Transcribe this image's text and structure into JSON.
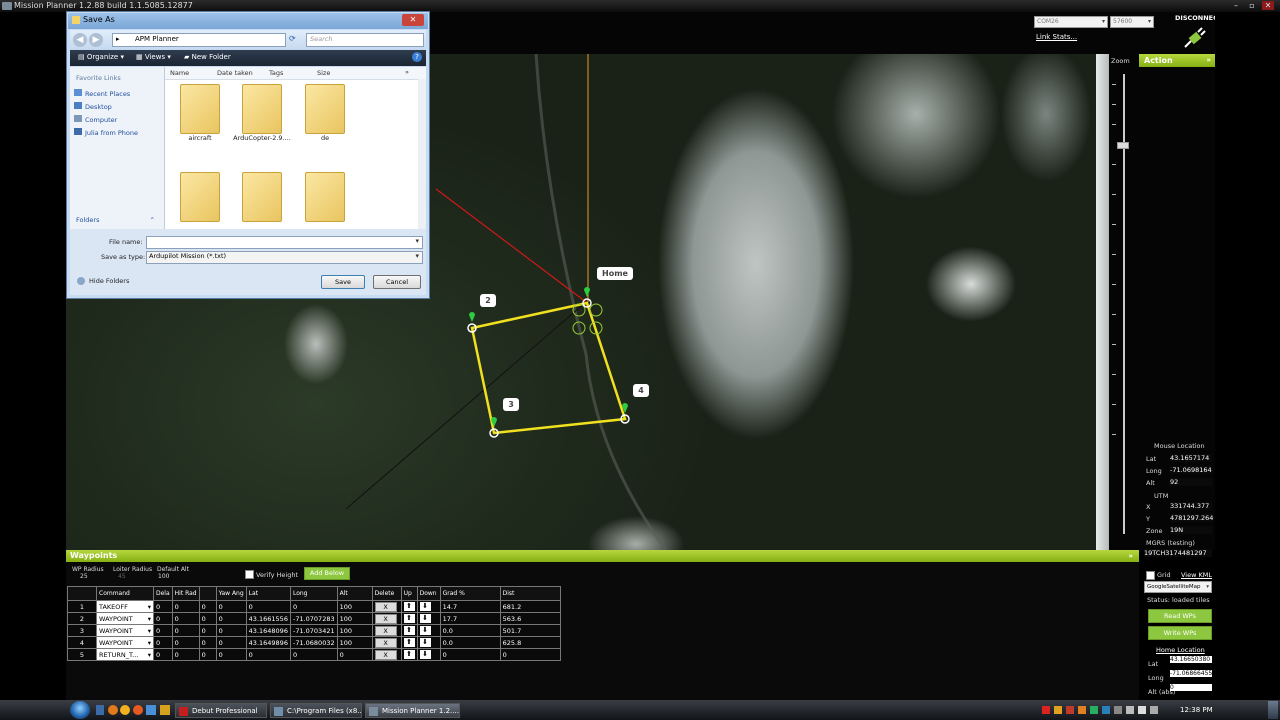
{
  "window": {
    "title": "Mission Planner 1.2.88 build 1.1.5085.12877"
  },
  "header": {
    "com_port": "COM26",
    "baud": "57600",
    "link_stats": "Link Stats...",
    "disconnect": "DISCONNECT"
  },
  "right_panel": {
    "action_label": "Action",
    "zoom_label": "Zoom",
    "mouse_location": "Mouse Location",
    "lat_label": "Lat",
    "lat_value": "43.1657174",
    "long_label": "Long",
    "long_value": "-71.0698164",
    "alt_label": "Alt",
    "alt_value": "92",
    "utm_label": "UTM",
    "x_label": "X",
    "x_value": "331744.377",
    "y_label": "Y",
    "y_value": "4781297.264",
    "zone_label": "Zone",
    "zone_value": "19N",
    "mgrs_label": "MGRS (testing)",
    "mgrs_value": "19TCH3174481297",
    "grid_label": "Grid",
    "view_kml": "View KML",
    "map_type": "GoogleSatelliteMap",
    "status": "Status: loaded tiles",
    "read_wps": "Read WPs",
    "write_wps": "Write WPs",
    "home_location": "Home Location",
    "home_lat_label": "Lat",
    "home_lat": "43.16650380",
    "home_long_label": "Long",
    "home_long": "-71.06866455",
    "home_alt_label": "Alt (abs)",
    "home_alt": "0"
  },
  "map": {
    "home_label": "Home",
    "wp_labels": [
      "2",
      "3",
      "4"
    ]
  },
  "waypoints": {
    "title": "Waypoints",
    "wp_radius_label": "WP Radius",
    "wp_radius": "25",
    "loiter_radius_label": "Loiter Radius",
    "loiter_radius": "45",
    "default_alt_label": "Default Alt",
    "default_alt": "100",
    "verify_height": "Verify Height",
    "add_below": "Add Below",
    "columns": [
      "",
      "Command",
      "Dela",
      "Hit Rad",
      "",
      "Yaw Ang",
      "Lat",
      "Long",
      "Alt",
      "Delete",
      "Up",
      "Down",
      "Grad %",
      "Dist"
    ],
    "rows": [
      {
        "idx": "1",
        "cmd": "TAKEOFF",
        "p1": "0",
        "p2": "0",
        "p3": "0",
        "p4": "0",
        "lat": "0",
        "lng": "0",
        "alt": "100",
        "grad": "14.7",
        "dist": "681.2"
      },
      {
        "idx": "2",
        "cmd": "WAYPOINT",
        "p1": "0",
        "p2": "0",
        "p3": "0",
        "p4": "0",
        "lat": "43.1661556",
        "lng": "-71.0707283",
        "alt": "100",
        "grad": "17.7",
        "dist": "563.6"
      },
      {
        "idx": "3",
        "cmd": "WAYPOINT",
        "p1": "0",
        "p2": "0",
        "p3": "0",
        "p4": "0",
        "lat": "43.1648096",
        "lng": "-71.0703421",
        "alt": "100",
        "grad": "0.0",
        "dist": "501.7"
      },
      {
        "idx": "4",
        "cmd": "WAYPOINT",
        "p1": "0",
        "p2": "0",
        "p3": "0",
        "p4": "0",
        "lat": "43.1649896",
        "lng": "-71.0680032",
        "alt": "100",
        "grad": "0.0",
        "dist": "625.8"
      },
      {
        "idx": "5",
        "cmd": "RETURN_T...",
        "p1": "0",
        "p2": "0",
        "p3": "0",
        "p4": "0",
        "lat": "0",
        "lng": "0",
        "alt": "0",
        "grad": "0",
        "dist": "0"
      }
    ],
    "delete_label": "X"
  },
  "dialog": {
    "title": "Save As",
    "path": "APM Planner",
    "search_placeholder": "Search",
    "organize": "Organize",
    "views": "Views",
    "new_folder": "New Folder",
    "favorite_links": "Favorite Links",
    "nav": [
      "Recent Places",
      "Desktop",
      "Computer",
      "Julia from Phone"
    ],
    "folders": "Folders",
    "col_name": "Name",
    "col_date": "Date taken",
    "col_tags": "Tags",
    "col_size": "Size",
    "files": [
      "aircraft",
      "ArduCopter-2.9....",
      "de",
      "",
      "",
      ""
    ],
    "file_name_label": "File name:",
    "file_name_value": "",
    "save_type_label": "Save as type:",
    "save_type_value": "Ardupilot Mission (*.txt)",
    "hide_folders": "Hide Folders",
    "save": "Save",
    "cancel": "Cancel"
  },
  "taskbar": {
    "items": [
      "Debut Professional",
      "C:\\Program Files (x8...",
      "Mission Planner 1.2...."
    ],
    "clock": "12:38 PM"
  }
}
